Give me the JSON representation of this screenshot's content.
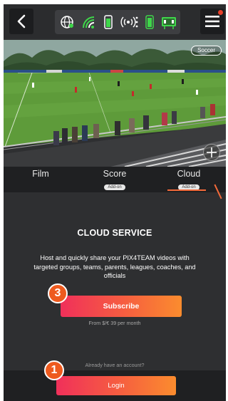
{
  "header": {
    "back_icon": "chevron-left-icon",
    "menu_icon": "hamburger-menu-icon",
    "status_icons": [
      "globe-icon",
      "wifi-signal-icon",
      "phone-battery-icon",
      "broadcast-signal-icon",
      "device-battery-icon",
      "scoreboard-icon"
    ],
    "notification_color": "#e8402a"
  },
  "video": {
    "sport_badge": "Soccer",
    "zoom_icon": "zoom-plus-icon"
  },
  "tabs": [
    {
      "label": "Film",
      "badge": ""
    },
    {
      "label": "Score",
      "badge": "Add-on"
    },
    {
      "label": "Cloud",
      "badge": "Add-on",
      "active": true
    }
  ],
  "cloud": {
    "title": "CLOUD SERVICE",
    "description": "Host and quickly share your PIX4TEAM videos with targeted groups, teams, parents, leagues, coaches, and officials",
    "subscribe_label": "Subscribe",
    "price_note": "From $/€ 39 per month",
    "account_note": "Already have an account?",
    "login_label": "Login"
  },
  "markers": {
    "subscribe_step": "3",
    "login_step": "1"
  },
  "colors": {
    "accent_gradient_start": "#f0305a",
    "accent_gradient_end": "#fb8c2e",
    "marker": "#ee5a1e",
    "tab_underline": "#f46a3a",
    "background": "#2e2f31"
  }
}
